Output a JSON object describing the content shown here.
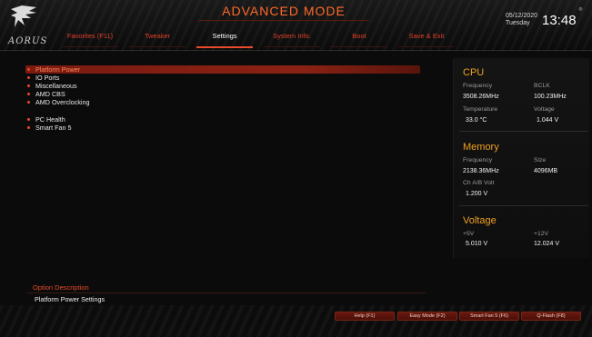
{
  "header": {
    "logo_text": "AORUS",
    "mode_title": "ADVANCED MODE",
    "tabs": [
      {
        "label": "Favorites (F11)",
        "active": false
      },
      {
        "label": "Tweaker",
        "active": false
      },
      {
        "label": "Settings",
        "active": true
      },
      {
        "label": "System Info.",
        "active": false
      },
      {
        "label": "Boot",
        "active": false
      },
      {
        "label": "Save & Exit",
        "active": false
      }
    ],
    "date": "05/12/2020",
    "day": "Tuesday",
    "time": "13:48",
    "reg_mark": "®"
  },
  "menu": {
    "items": [
      {
        "label": "Platform Power",
        "selected": true
      },
      {
        "label": "IO Ports",
        "selected": false
      },
      {
        "label": "Miscellaneous",
        "selected": false
      },
      {
        "label": "AMD CBS",
        "selected": false
      },
      {
        "label": "AMD Overclocking",
        "selected": false
      },
      {
        "label": "PC Health",
        "selected": false
      },
      {
        "label": "Smart Fan 5",
        "selected": false
      }
    ]
  },
  "panel": {
    "cpu": {
      "title": "CPU",
      "frequency_label": "Frequency",
      "frequency_value": "3508.26MHz",
      "bclk_label": "BCLK",
      "bclk_value": "100.23MHz",
      "temperature_label": "Temperature",
      "temperature_value": "33.0 °C",
      "voltage_label": "Voltage",
      "voltage_value": "1.044 V"
    },
    "memory": {
      "title": "Memory",
      "frequency_label": "Frequency",
      "frequency_value": "2138.36MHz",
      "size_label": "Size",
      "size_value": "4096MB",
      "chab_label": "Ch A/B Volt",
      "chab_value": "1.200 V"
    },
    "voltage": {
      "title": "Voltage",
      "p5v_label": "+5V",
      "p5v_value": "5.010 V",
      "p12v_label": "+12V",
      "p12v_value": "12.024 V"
    }
  },
  "description": {
    "title": "Option Description",
    "text": "Platform Power Settings"
  },
  "footer": {
    "buttons": [
      {
        "label": "Help (F1)"
      },
      {
        "label": "Easy Mode (F2)"
      },
      {
        "label": "Smart Fan 5 (F6)"
      },
      {
        "label": "Q-Flash (F8)"
      }
    ]
  },
  "colors": {
    "accent": "#e84a2a",
    "section_title": "#f0a020",
    "background": "#0b0b0b"
  }
}
